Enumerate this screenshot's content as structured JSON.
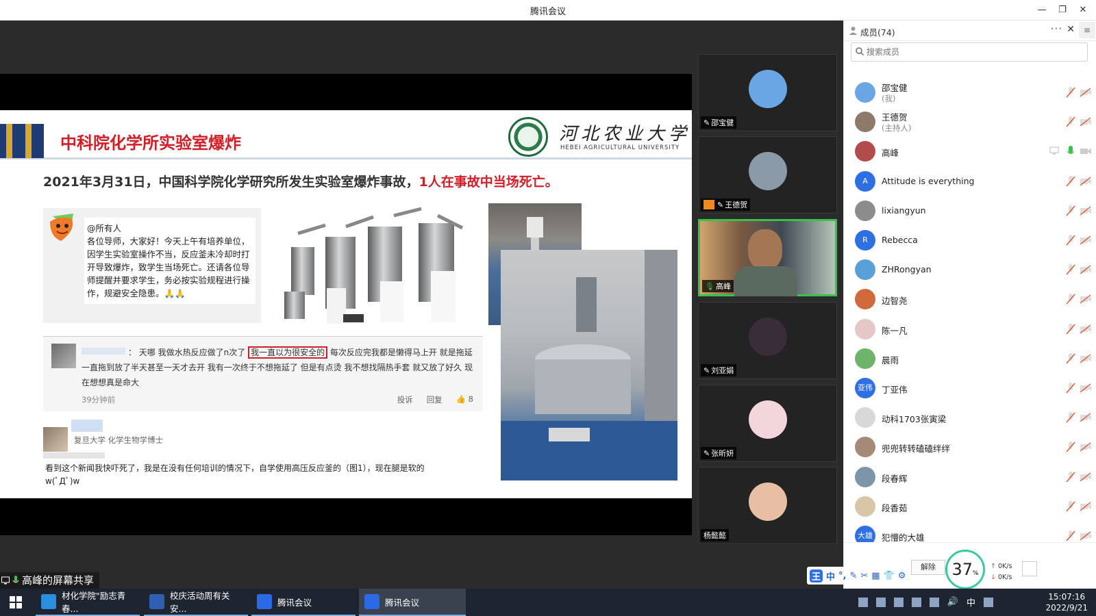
{
  "window": {
    "title": "腾讯会议"
  },
  "slide": {
    "title": "中科院化学所实验室爆炸",
    "university_cn": "河北农业大学",
    "university_en": "HEBEI AGRICULTURAL UNIVERSITY",
    "subtitle": "2021年3月31日，中国科学院化学研究所发生实验室爆炸事故，",
    "subtitle_red": "1人在事故中当场死亡。",
    "wechat_msg": "@所有人\n各位导师，大家好！今天上午有培养单位，因学生实验室操作不当，反应釜未冷却时打开导致爆炸，致学生当场死亡。还请各位导师提醒并要求学生，务必按实验规程进行操作，规避安全隐患。🙏🙏",
    "comment_lead": "：  天哪 我做水热反应做了n次了 ",
    "comment_boxed": "我一直以为很安全的",
    "comment_rest": " 每次反应完我都是懒得马上开 就是拖延一直拖到放了半天甚至一天才去开 我有一次终于不想拖延了 但是有点烫 我不想找隔热手套 就又放了好久 现在想想真是命大",
    "comment_time": "39分钟前",
    "comment_report": "投诉",
    "comment_reply": "回复",
    "comment_likes": "8",
    "reply_meta": "复旦大学 化学生物学博士",
    "reply_text": "看到这个新闻我快吓死了，我是在没有任何培训的情况下，自学使用高压反应釜的（图1），现在腿是软的 w(ﾟДﾟ)w"
  },
  "share_label": "高峰的屏幕共享",
  "tiles": [
    {
      "name": "邵宝健",
      "face": "#6aa6e3",
      "host": false
    },
    {
      "name": "王德贺",
      "face": "#8a9aa8",
      "host": true
    },
    {
      "name": "高峰",
      "face": "#a57654",
      "host": false,
      "active": true
    },
    {
      "name": "刘亚娟",
      "face": "#3a2d3a",
      "host": false
    },
    {
      "name": "张昕妍",
      "face": "#f3d6dc",
      "host": false
    },
    {
      "name": "杨懿懿",
      "face": "#e8bfa4",
      "host": false,
      "nomic": true
    }
  ],
  "panel": {
    "title": "成员(74)",
    "more": "···",
    "close": "✕",
    "menu": "≡",
    "search_placeholder": "搜索成员",
    "members": [
      {
        "name": "邵宝健",
        "sub": "(我)",
        "avatar": "",
        "color": "#6aa6e3"
      },
      {
        "name": "王德贺",
        "sub": "(主持人)",
        "avatar": "",
        "color": "#8d7a68"
      },
      {
        "name": "高峰",
        "sub": "",
        "avatar": "",
        "color": "#b24c4c",
        "speaking": true
      },
      {
        "name": "Attitude is everything",
        "sub": "",
        "avatar": "A",
        "color": "#2f6fe4"
      },
      {
        "name": "lixiangyun",
        "sub": "",
        "avatar": "",
        "color": "#8c8c8c"
      },
      {
        "name": "Rebecca",
        "sub": "",
        "avatar": "R",
        "color": "#2f6fe4"
      },
      {
        "name": "ZHRongyan",
        "sub": "",
        "avatar": "",
        "color": "#5aa0d8"
      },
      {
        "name": "边智尧",
        "sub": "",
        "avatar": "",
        "color": "#d06a3c"
      },
      {
        "name": "陈一凡",
        "sub": "",
        "avatar": "",
        "color": "#e4c7c7"
      },
      {
        "name": "晨雨",
        "sub": "",
        "avatar": "",
        "color": "#6db36a"
      },
      {
        "name": "丁亚伟",
        "sub": "",
        "avatar": "亚伟",
        "color": "#2f6fe4"
      },
      {
        "name": "动科1703张寅梁",
        "sub": "",
        "avatar": "",
        "color": "#d8d8d8"
      },
      {
        "name": "兜兜转转磕磕绊绊",
        "sub": "",
        "avatar": "",
        "color": "#a58a78"
      },
      {
        "name": "段春辉",
        "sub": "",
        "avatar": "",
        "color": "#7c95a8"
      },
      {
        "name": "段香茹",
        "sub": "",
        "avatar": "",
        "color": "#d9c6a6"
      },
      {
        "name": "犯懵的大雄",
        "sub": "",
        "avatar": "大雄",
        "color": "#2f6fe4"
      }
    ],
    "unmute_label": "解除",
    "gauge_value": "37",
    "gauge_unit": "%",
    "net_up": "0K/s",
    "net_down": "0K/s"
  },
  "ime": {
    "logo": "王",
    "items": [
      "中",
      "°,",
      "✎",
      "✂",
      "▦",
      "👕",
      "⚙"
    ]
  },
  "taskbar": {
    "tasks": [
      {
        "label": "材化学院\"励志青春...",
        "color": "#2b8fe0"
      },
      {
        "label": "校庆活动周有关安...",
        "color": "#2f5fb3"
      },
      {
        "label": "腾讯会议",
        "color": "#2a6ae8"
      },
      {
        "label": "腾讯会议",
        "color": "#2a6ae8",
        "active": true
      }
    ],
    "tray_lang": "中",
    "time": "15:07:16",
    "date": "2022/9/21"
  },
  "colors": {
    "stripe_dark": "#1f3b73",
    "stripe_gold": "#d8a72b",
    "slide_red": "#d51d26",
    "speaking_green": "#37c24c"
  }
}
